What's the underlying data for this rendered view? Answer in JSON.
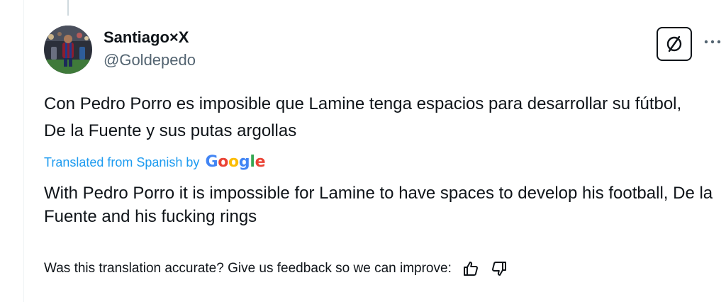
{
  "author": {
    "display_name": "Santiago×X",
    "handle": "@Goldepedo"
  },
  "tweet": {
    "original_text": "Con Pedro Porro es imposible que Lamine tenga espacios para desarrollar su fútbol, De la Fuente y sus putas argollas",
    "translated_from_label": "Translated from Spanish by",
    "translation_provider": "Google",
    "translated_text": "With Pedro Porro it is impossible for Lamine to have spaces to develop his football, De la Fuente and his fucking rings"
  },
  "feedback": {
    "prompt": "Was this translation accurate? Give us feedback so we can improve:"
  },
  "icons": {
    "translate_toggle": "slashed-circle-icon",
    "more": "more-dots-icon",
    "thumbs_up": "thumbs-up-icon",
    "thumbs_down": "thumbs-down-icon"
  },
  "colors": {
    "link_blue": "#1d9bf0",
    "text": "#0f1419",
    "secondary_text": "#536471",
    "google_blue": "#4285f4",
    "google_red": "#ea4335",
    "google_yellow": "#fbbc05",
    "google_green": "#34a853"
  }
}
